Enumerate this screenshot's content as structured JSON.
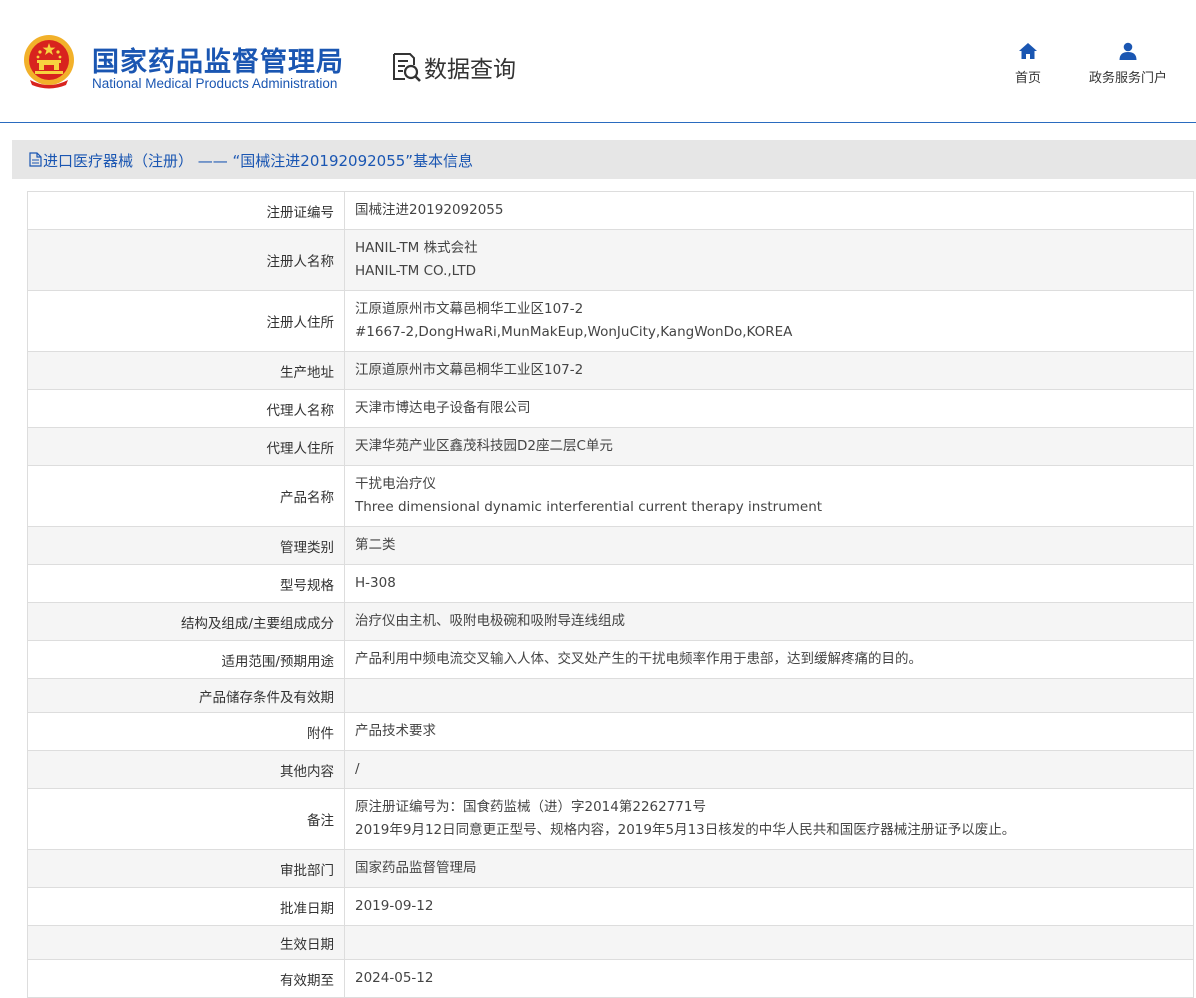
{
  "header": {
    "emblem_icon": "national-emblem-icon",
    "brand_cn": "国家药品监督管理局",
    "brand_en": "National Medical Products Administration",
    "query_icon": "data-search-icon",
    "query_label": "数据查询",
    "nav": [
      {
        "icon": "home-icon",
        "label": "首页"
      },
      {
        "icon": "user-icon",
        "label": "政务服务门户"
      }
    ]
  },
  "title_bar": {
    "icon": "document-icon",
    "text": "进口医疗器械（注册） —— “国械注进20192092055”基本信息"
  },
  "rows": [
    {
      "label": "注册证编号",
      "lines": [
        "国械注进20192092055"
      ]
    },
    {
      "label": "注册人名称",
      "lines": [
        "HANIL-TM 株式会社",
        "HANIL-TM CO.,LTD"
      ]
    },
    {
      "label": "注册人住所",
      "lines": [
        "江原道原州市文幕邑桐华工业区107-2",
        "#1667-2,DongHwaRi,MunMakEup,WonJuCity,KangWonDo,KOREA"
      ]
    },
    {
      "label": "生产地址",
      "lines": [
        "江原道原州市文幕邑桐华工业区107-2"
      ]
    },
    {
      "label": "代理人名称",
      "lines": [
        "天津市博达电子设备有限公司"
      ]
    },
    {
      "label": "代理人住所",
      "lines": [
        "天津华苑产业区鑫茂科技园D2座二层C单元"
      ]
    },
    {
      "label": "产品名称",
      "lines": [
        "干扰电治疗仪",
        "Three dimensional dynamic interferential current therapy instrument"
      ]
    },
    {
      "label": "管理类别",
      "lines": [
        "第二类"
      ]
    },
    {
      "label": "型号规格",
      "lines": [
        "H-308"
      ]
    },
    {
      "label": "结构及组成/主要组成成分",
      "lines": [
        "治疗仪由主机、吸附电极碗和吸附导连线组成"
      ]
    },
    {
      "label": "适用范围/预期用途",
      "lines": [
        "产品利用中频电流交叉输入人体、交叉处产生的干扰电频率作用于患部，达到缓解疼痛的目的。"
      ]
    },
    {
      "label": "产品储存条件及有效期",
      "lines": [
        ""
      ]
    },
    {
      "label": "附件",
      "lines": [
        "产品技术要求"
      ]
    },
    {
      "label": "其他内容",
      "lines": [
        "/"
      ]
    },
    {
      "label": "备注",
      "lines": [
        "原注册证编号为：国食药监械（进）字2014第2262771号",
        "2019年9月12日同意更正型号、规格内容，2019年5月13日核发的中华人民共和国医疗器械注册证予以废止。"
      ]
    },
    {
      "label": "审批部门",
      "lines": [
        "国家药品监督管理局"
      ]
    },
    {
      "label": "批准日期",
      "lines": [
        "2019-09-12"
      ]
    },
    {
      "label": "生效日期",
      "lines": [
        ""
      ]
    },
    {
      "label": "有效期至",
      "lines": [
        "2024-05-12"
      ]
    }
  ]
}
